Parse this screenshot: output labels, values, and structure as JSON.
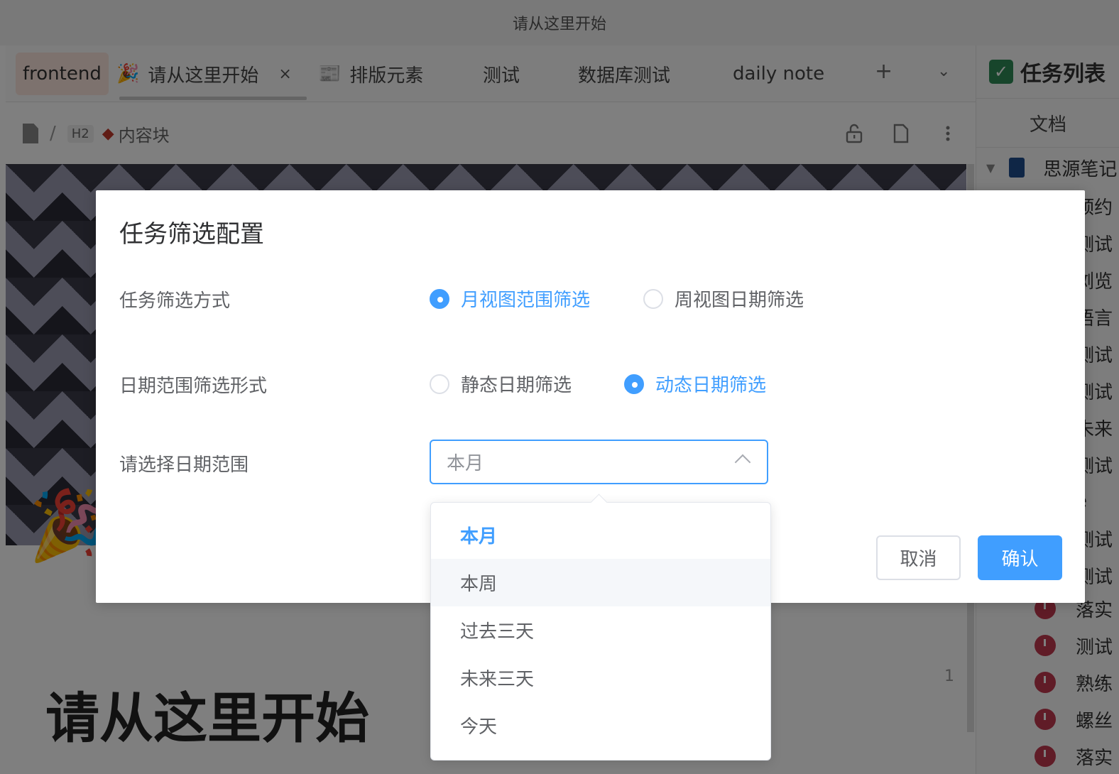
{
  "window": {
    "title": "请从这里开始"
  },
  "tabs": [
    {
      "label": "frontend"
    },
    {
      "icon": "🎉",
      "label": "请从这里开始",
      "close": "×"
    },
    {
      "icon": "📰",
      "label": "排版元素"
    },
    {
      "label": "测试"
    },
    {
      "label": "数据库测试"
    },
    {
      "label": "daily note"
    }
  ],
  "tab_actions": {
    "add": "+",
    "more": "⌄"
  },
  "breadcrumb": {
    "separator": "/",
    "heading": "H2",
    "block": "内容块"
  },
  "editor": {
    "party_icon": "🎉",
    "title": "请从这里开始",
    "line_number": "1"
  },
  "dock": {
    "title": "任务列表",
    "tab": "文档",
    "root": "思源笔记",
    "items": [
      "预约",
      "测试",
      "浏览",
      "语言",
      "测试",
      "测试",
      "未来",
      "测试",
      "e",
      "测试",
      "测试",
      "落实",
      "测试",
      "熟练",
      "螺丝",
      "落实"
    ]
  },
  "dialog": {
    "title": "任务筛选配置",
    "filter_mode": {
      "label": "任务筛选方式",
      "options": [
        "月视图范围筛选",
        "周视图日期筛选"
      ],
      "selected": "月视图范围筛选"
    },
    "range_form": {
      "label": "日期范围筛选形式",
      "options": [
        "静态日期筛选",
        "动态日期筛选"
      ],
      "selected": "动态日期筛选"
    },
    "range_select": {
      "label": "请选择日期范围",
      "value": "本月"
    },
    "cancel_label": "取消",
    "confirm_label": "确认"
  },
  "dropdown": {
    "options": [
      "本月",
      "本周",
      "过去三天",
      "未来三天",
      "今天"
    ],
    "selected": "本月",
    "hovered": "本周"
  },
  "colors": {
    "primary": "#409eff",
    "overlay": "rgba(0,0,0,0.5)"
  }
}
